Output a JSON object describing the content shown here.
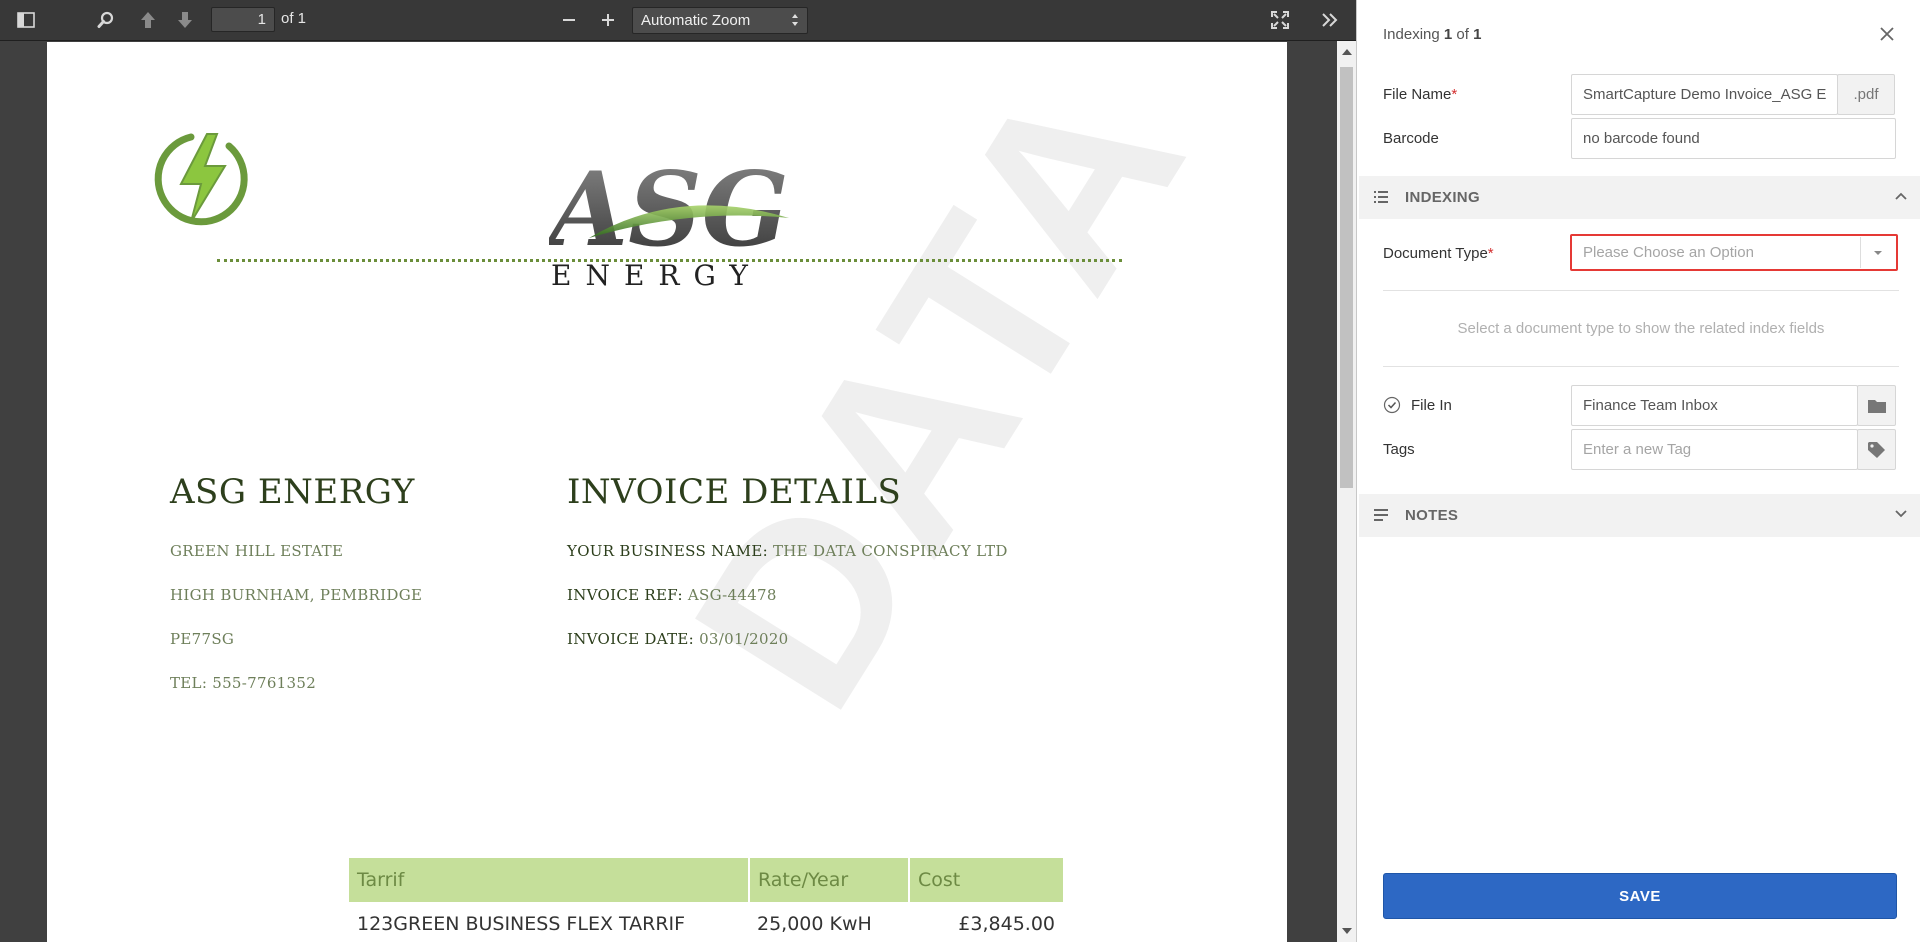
{
  "viewer": {
    "page_current": "1",
    "page_of": "of 1",
    "zoom_label": "Automatic Zoom"
  },
  "document": {
    "watermark": "DATA",
    "logo_text": "ASG",
    "logo_subtext": "ENERGY",
    "company": {
      "heading": "ASG ENERGY",
      "address1": "GREEN HILL ESTATE",
      "address2": "HIGH BURNHAM, PEMBRIDGE",
      "postcode": "PE77SG",
      "tel": "TEL: 555-7761352"
    },
    "invoice": {
      "heading": "INVOICE DETAILS",
      "business_label": "YOUR BUSINESS NAME:",
      "business_value": "THE DATA CONSPIRACY LTD",
      "ref_label": "INVOICE REF:",
      "ref_value": "ASG-44478",
      "date_label": "INVOICE DATE:",
      "date_value": "03/01/2020"
    },
    "table": {
      "headers": [
        "Tarrif",
        "Rate/Year",
        "Cost"
      ],
      "rows": [
        [
          "123GREEN BUSINESS FLEX TARRIF",
          "25,000 KwH",
          "£3,845.00"
        ]
      ]
    }
  },
  "panel": {
    "indexing_prefix": "Indexing",
    "indexing_current": "1",
    "indexing_of": "of",
    "indexing_total": "1",
    "file_name_label": "File Name",
    "file_name_value": "SmartCapture Demo Invoice_ASG E",
    "file_ext": ".pdf",
    "barcode_label": "Barcode",
    "barcode_value": "no barcode found",
    "indexing_section": "INDEXING",
    "doc_type_label": "Document Type",
    "doc_type_placeholder": "Please Choose an Option",
    "doc_type_hint": "Select a document type to show the related index fields",
    "file_in_label": "File In",
    "file_in_value": "Finance Team Inbox",
    "tags_label": "Tags",
    "tags_placeholder": "Enter a new Tag",
    "notes_section": "NOTES",
    "save_label": "SAVE",
    "required_mark": "*"
  },
  "colors": {
    "accent": "#2d68c4",
    "required": "#d32f2f",
    "highlight_border": "#e53935",
    "brand_green": "#6b8e3a"
  }
}
